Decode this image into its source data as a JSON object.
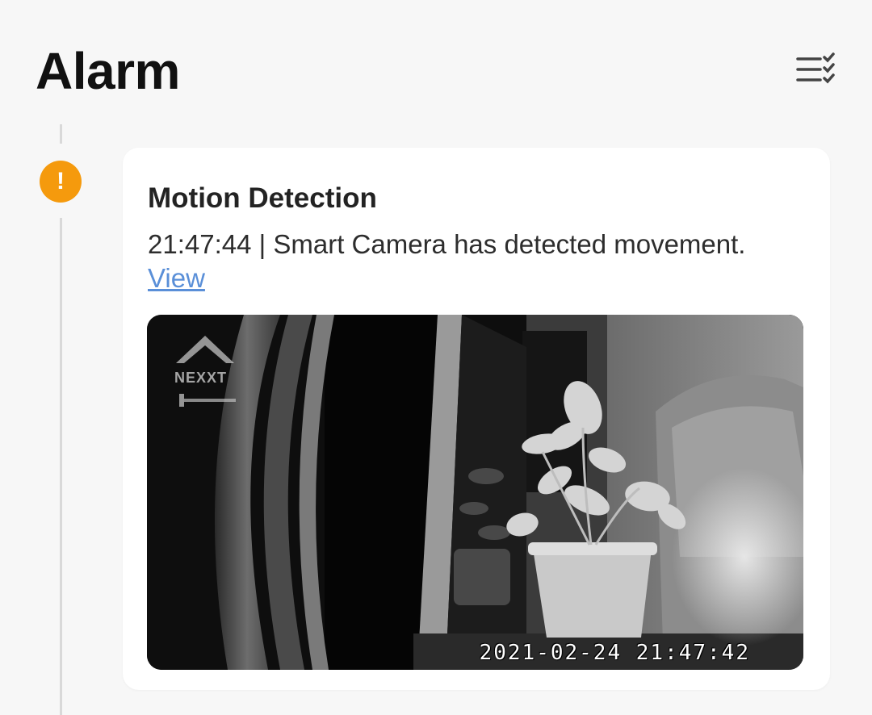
{
  "header": {
    "title": "Alarm",
    "filter_icon": "list-check-icon"
  },
  "events": [
    {
      "status_icon": "exclamation-icon",
      "status_color": "#f59a0d",
      "title": "Motion Detection",
      "description": "21:47:44 | Smart Camera has detected movement.",
      "link_label": "View",
      "snapshot": {
        "brand": "NEXXT",
        "timestamp": "2021-02-24 21:47:42"
      }
    }
  ],
  "colors": {
    "background": "#f7f7f7",
    "card": "#ffffff",
    "link": "#5a8fd8",
    "timeline": "#d9d9d9"
  }
}
